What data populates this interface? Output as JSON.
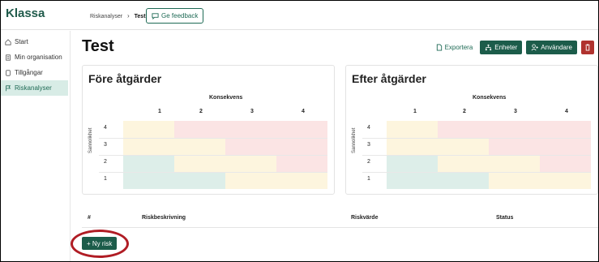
{
  "app": {
    "brand": "Klassa"
  },
  "breadcrumb": {
    "parent": "Riskanalyser",
    "current": "Test"
  },
  "header": {
    "feedback_label": "Ge feedback"
  },
  "sidebar": {
    "items": [
      {
        "label": "Start",
        "icon": "home-icon",
        "active": false
      },
      {
        "label": "Min organisation",
        "icon": "building-icon",
        "active": false
      },
      {
        "label": "Tillgångar",
        "icon": "document-icon",
        "active": false
      },
      {
        "label": "Riskanalyser",
        "icon": "flag-icon",
        "active": true
      }
    ]
  },
  "page": {
    "title": "Test"
  },
  "actions": {
    "export_label": "Exportera",
    "units_label": "Enheter",
    "users_label": "Användare",
    "delete_icon": "trash-icon"
  },
  "matrix": {
    "x_axis_label": "Konsekvens",
    "y_axis_label": "Sannolikhet",
    "columns": [
      "1",
      "2",
      "3",
      "4"
    ],
    "rows": [
      "4",
      "3",
      "2",
      "1"
    ],
    "colors": {
      "yellow": "#fdf5de",
      "red": "#fbe4e4",
      "green": "#ddeee9"
    }
  },
  "before": {
    "title": "Före åtgärder"
  },
  "after": {
    "title": "Efter åtgärder"
  },
  "table": {
    "columns": [
      "#",
      "Riskbeskrivning",
      "Riskvärde",
      "Status"
    ]
  },
  "new_risk": {
    "label": "+ Ny risk"
  }
}
